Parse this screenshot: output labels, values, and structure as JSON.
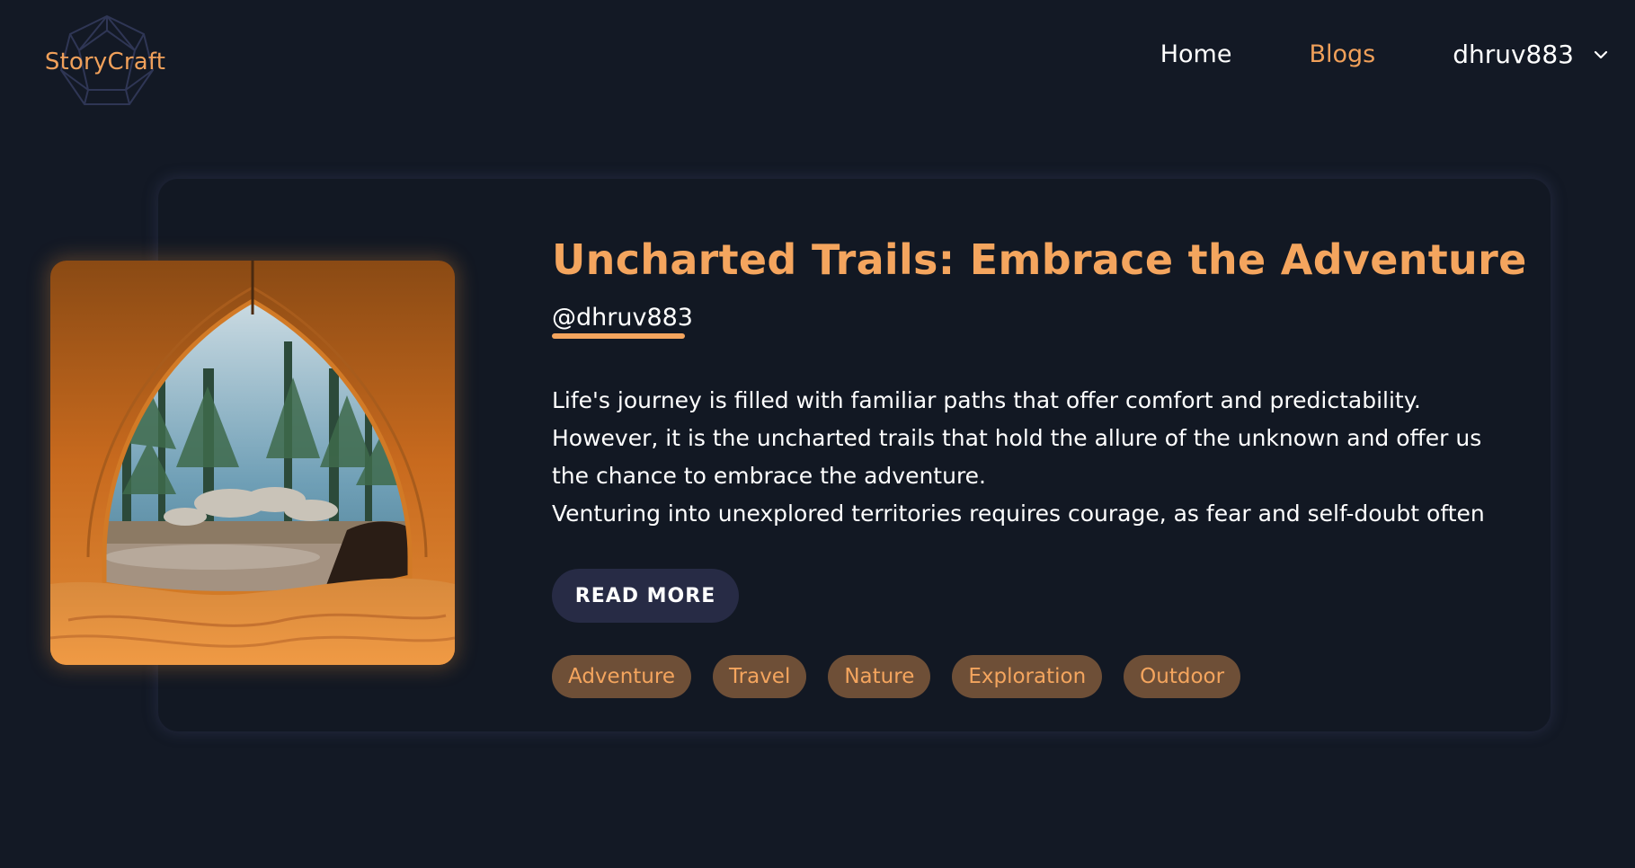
{
  "brand": {
    "name": "StoryCraft"
  },
  "nav": {
    "home": "Home",
    "blogs": "Blogs",
    "username": "dhruv883"
  },
  "post": {
    "title": "Uncharted Trails: Embrace the Adventure",
    "author": "@dhruv883",
    "excerpt": "Life's journey is filled with familiar paths that offer comfort and predictability. However, it is the uncharted trails that hold the allure of the unknown and offer us the chance to embrace the adventure.\nVenturing into unexplored territories requires courage, as fear and self-doubt often",
    "read_more": "READ MORE",
    "tags": [
      "Adventure",
      "Travel",
      "Nature",
      "Exploration",
      "Outdoor"
    ]
  },
  "colors": {
    "background": "#131925",
    "accent": "#f4a55e",
    "tag_bg": "#6e4f37",
    "button_bg": "#272b45"
  }
}
